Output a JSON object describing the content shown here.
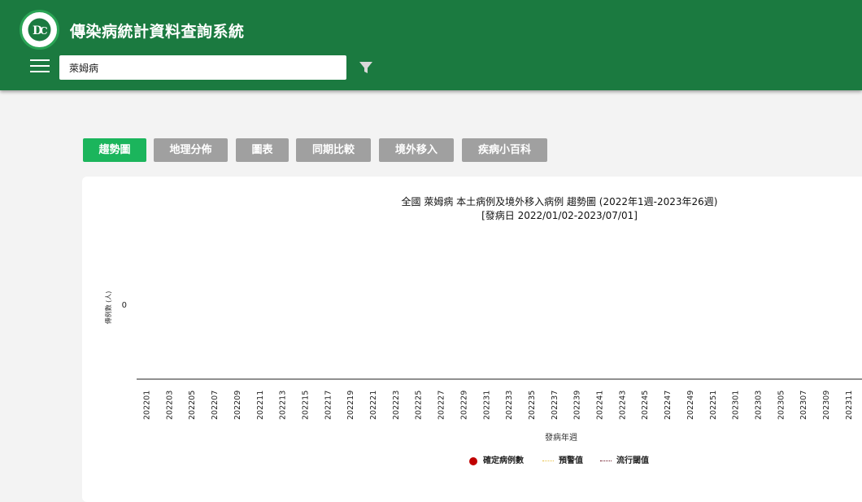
{
  "app": {
    "title": "傳染病統計資料查詢系統"
  },
  "search": {
    "value": "萊姆病"
  },
  "tabs": [
    {
      "label": "趨勢圖",
      "active": true
    },
    {
      "label": "地理分佈",
      "active": false
    },
    {
      "label": "圖表",
      "active": false
    },
    {
      "label": "同期比較",
      "active": false
    },
    {
      "label": "境外移入",
      "active": false
    },
    {
      "label": "疾病小百科",
      "active": false
    }
  ],
  "colors": {
    "header": "#1b7a40",
    "active_tab": "#1bb55c",
    "inactive_tab": "#a0a0a0",
    "confirmed": "#c00000",
    "alert": "#e8c040",
    "epidemic": "#6a1020"
  },
  "icons": [
    "menu-icon",
    "filter-icon"
  ],
  "chart_data": {
    "type": "line",
    "title": "全國 萊姆病 本土病例及境外移入病例 趨勢圖 (2022年1週-2023年26週)",
    "subtitle": "[發病日 2022/01/02-2023/07/01]",
    "xlabel": "發病年週",
    "ylabel": "傳例數 (人)",
    "y_ticks": [
      "0"
    ],
    "x": [
      "202201",
      "202203",
      "202205",
      "202207",
      "202209",
      "202211",
      "202213",
      "202215",
      "202217",
      "202219",
      "202221",
      "202223",
      "202225",
      "202227",
      "202229",
      "202231",
      "202233",
      "202235",
      "202237",
      "202239",
      "202241",
      "202243",
      "202245",
      "202247",
      "202249",
      "202251",
      "202301",
      "202303",
      "202305",
      "202307",
      "202309",
      "202311"
    ],
    "series": [
      {
        "name": "確定病例數",
        "values": [
          0,
          0,
          0,
          0,
          0,
          0,
          0,
          0,
          0,
          0,
          0,
          0,
          0,
          0,
          0,
          0,
          0,
          0,
          0,
          0,
          0,
          0,
          0,
          0,
          0,
          0,
          0,
          0,
          0,
          0,
          0,
          0
        ]
      },
      {
        "name": "預警值",
        "values": []
      },
      {
        "name": "流行閾值",
        "values": []
      }
    ],
    "legend": "bottom-center"
  }
}
